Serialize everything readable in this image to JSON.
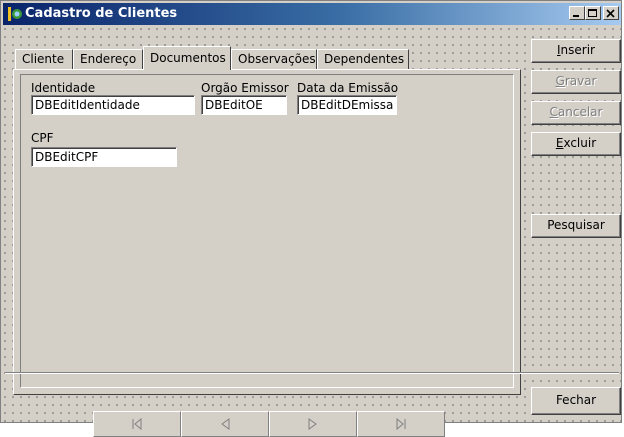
{
  "window": {
    "title": "Cadastro de Clientes",
    "colors": {
      "titlebar_start": "#0a246a",
      "titlebar_end": "#a6caf0",
      "face": "#d4d0c8"
    }
  },
  "tabs": [
    {
      "label": "Cliente"
    },
    {
      "label": "Endereço"
    },
    {
      "label": "Documentos",
      "active": true
    },
    {
      "label": "Observações"
    },
    {
      "label": "Dependentes"
    }
  ],
  "form": {
    "identidade": {
      "label": "Identidade",
      "value": "DBEditIdentidade"
    },
    "orgao": {
      "label": "Orgão Emissor",
      "value": "DBEditOE"
    },
    "data_emissao": {
      "label": "Data da Emissão",
      "value": "DBEditDEmissa"
    },
    "cpf": {
      "label": "CPF",
      "value": "DBEditCPF"
    }
  },
  "buttons": {
    "inserir": {
      "accel": "I",
      "rest": "nserir",
      "enabled": true
    },
    "gravar": {
      "accel": "G",
      "rest": "ravar",
      "enabled": false
    },
    "cancelar": {
      "accel": "C",
      "rest": "ancelar",
      "enabled": false
    },
    "excluir": {
      "accel": "E",
      "rest": "xcluir",
      "enabled": true
    },
    "pesquisar": {
      "label": "Pesquisar",
      "enabled": true
    },
    "fechar": {
      "label": "Fechar",
      "enabled": true
    }
  },
  "navigator": {
    "buttons": [
      "first-record-icon",
      "prior-record-icon",
      "next-record-icon",
      "last-record-icon"
    ],
    "enabled": false
  }
}
